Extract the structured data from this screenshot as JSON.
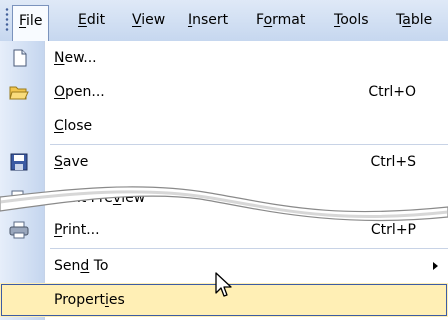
{
  "menubar": {
    "items": [
      {
        "name": "menu-file",
        "pre": "",
        "u": "F",
        "post": "ile"
      },
      {
        "name": "menu-edit",
        "pre": "",
        "u": "E",
        "post": "dit"
      },
      {
        "name": "menu-view",
        "pre": "",
        "u": "V",
        "post": "iew"
      },
      {
        "name": "menu-insert",
        "pre": "",
        "u": "I",
        "post": "nsert"
      },
      {
        "name": "menu-format",
        "pre": "F",
        "u": "o",
        "post": "rmat"
      },
      {
        "name": "menu-tools",
        "pre": "",
        "u": "T",
        "post": "ools"
      },
      {
        "name": "menu-table",
        "pre": "T",
        "u": "a",
        "post": "ble"
      }
    ]
  },
  "file_menu": {
    "items": [
      {
        "pre": "",
        "u": "N",
        "post": "ew...",
        "shortcut": "",
        "icon": "new-document-icon"
      },
      {
        "pre": "",
        "u": "O",
        "post": "pen...",
        "shortcut": "Ctrl+O",
        "icon": "open-folder-icon"
      },
      {
        "pre": "",
        "u": "C",
        "post": "lose",
        "shortcut": "",
        "icon": ""
      },
      {
        "pre": "",
        "u": "S",
        "post": "ave",
        "shortcut": "Ctrl+S",
        "icon": "save-disk-icon"
      },
      {
        "pre": "Print Pre",
        "u": "v",
        "post": "iew",
        "shortcut": "",
        "icon": "print-preview-icon"
      },
      {
        "pre": "",
        "u": "P",
        "post": "rint...",
        "shortcut": "Ctrl+P",
        "icon": "printer-icon"
      },
      {
        "pre": "Sen",
        "u": "d",
        "post": " To",
        "shortcut": "",
        "icon": "submenu-arrow-icon"
      },
      {
        "pre": "Propert",
        "u": "i",
        "post": "es",
        "shortcut": "",
        "icon": ""
      }
    ]
  },
  "colors": {
    "menubar_bg": "#c6d7ef",
    "icon_strip": "#d4e0f4",
    "highlight_bg": "#ffefb5",
    "highlight_border": "#3d5ca4"
  }
}
